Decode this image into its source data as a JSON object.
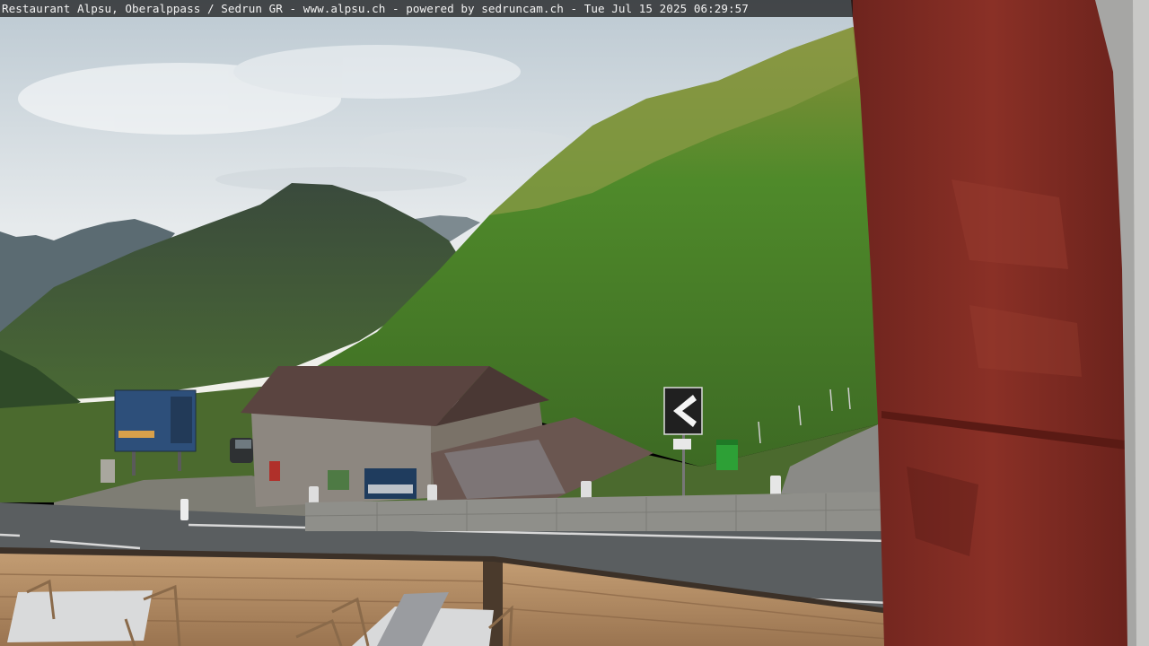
{
  "overlay": {
    "caption": "Restaurant Alpsu, Oberalppass / Sedrun GR - www.alpsu.ch - powered by sedruncam.ch -  Tue Jul 15 2025 06:29:57"
  },
  "colors": {
    "sky_top": "#c9d6df",
    "sky_bottom": "#eef1f2",
    "mountain_far": "#5a6a6d",
    "mountain_mid": "#3f5a3c",
    "slope_green": "#4a7a2a",
    "slope_lit": "#8c9a3c",
    "roof": "#5a4440",
    "road": "#555a5c",
    "wall": "#8f8f8a",
    "pillar": "#7e2a22",
    "fence_wood": "#b08a62"
  }
}
